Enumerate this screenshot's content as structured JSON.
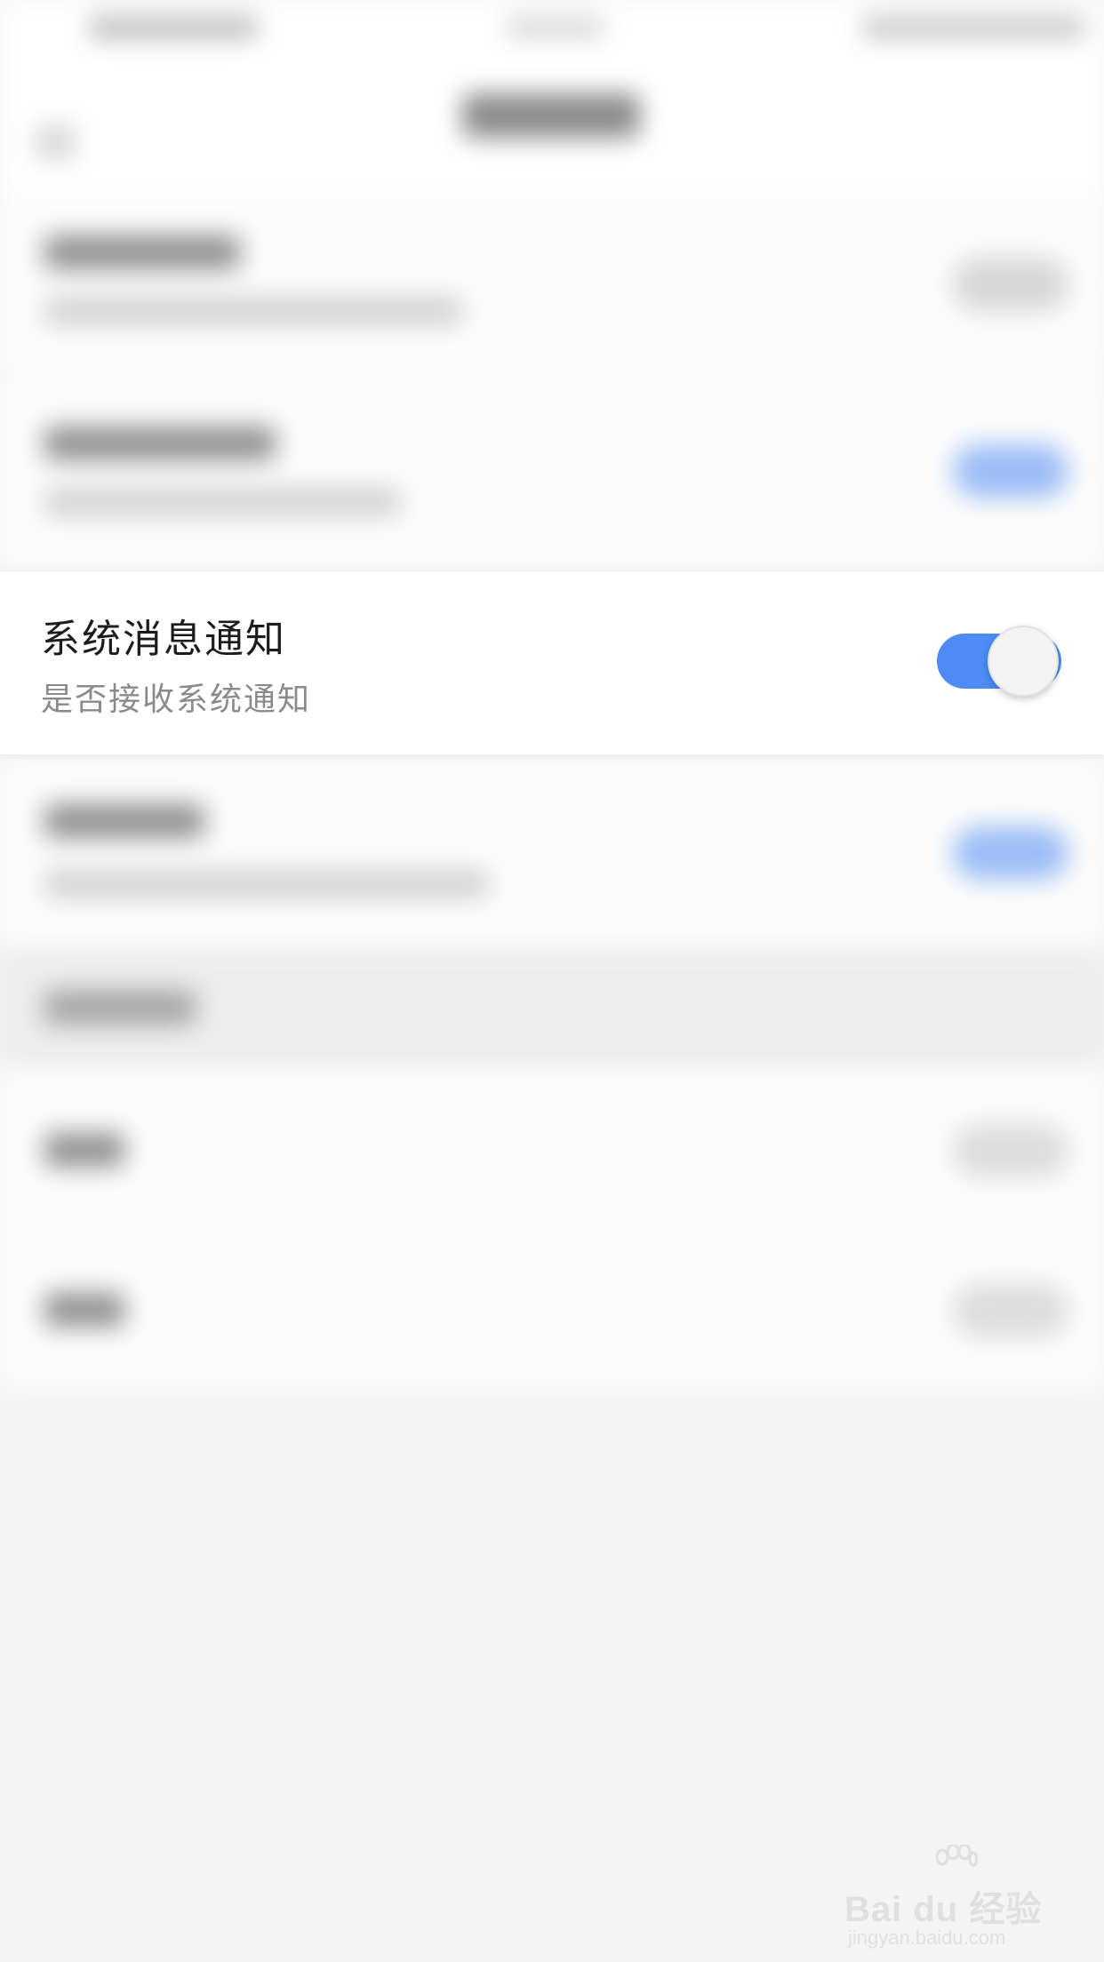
{
  "focused_setting": {
    "title": "系统消息通知",
    "subtitle": "是否接收系统通知",
    "toggle_on": true,
    "toggle_color": "#4d8cf5"
  },
  "watermark": {
    "logo_text": "Bai du 经验",
    "url": "jingyan.baidu.com"
  }
}
